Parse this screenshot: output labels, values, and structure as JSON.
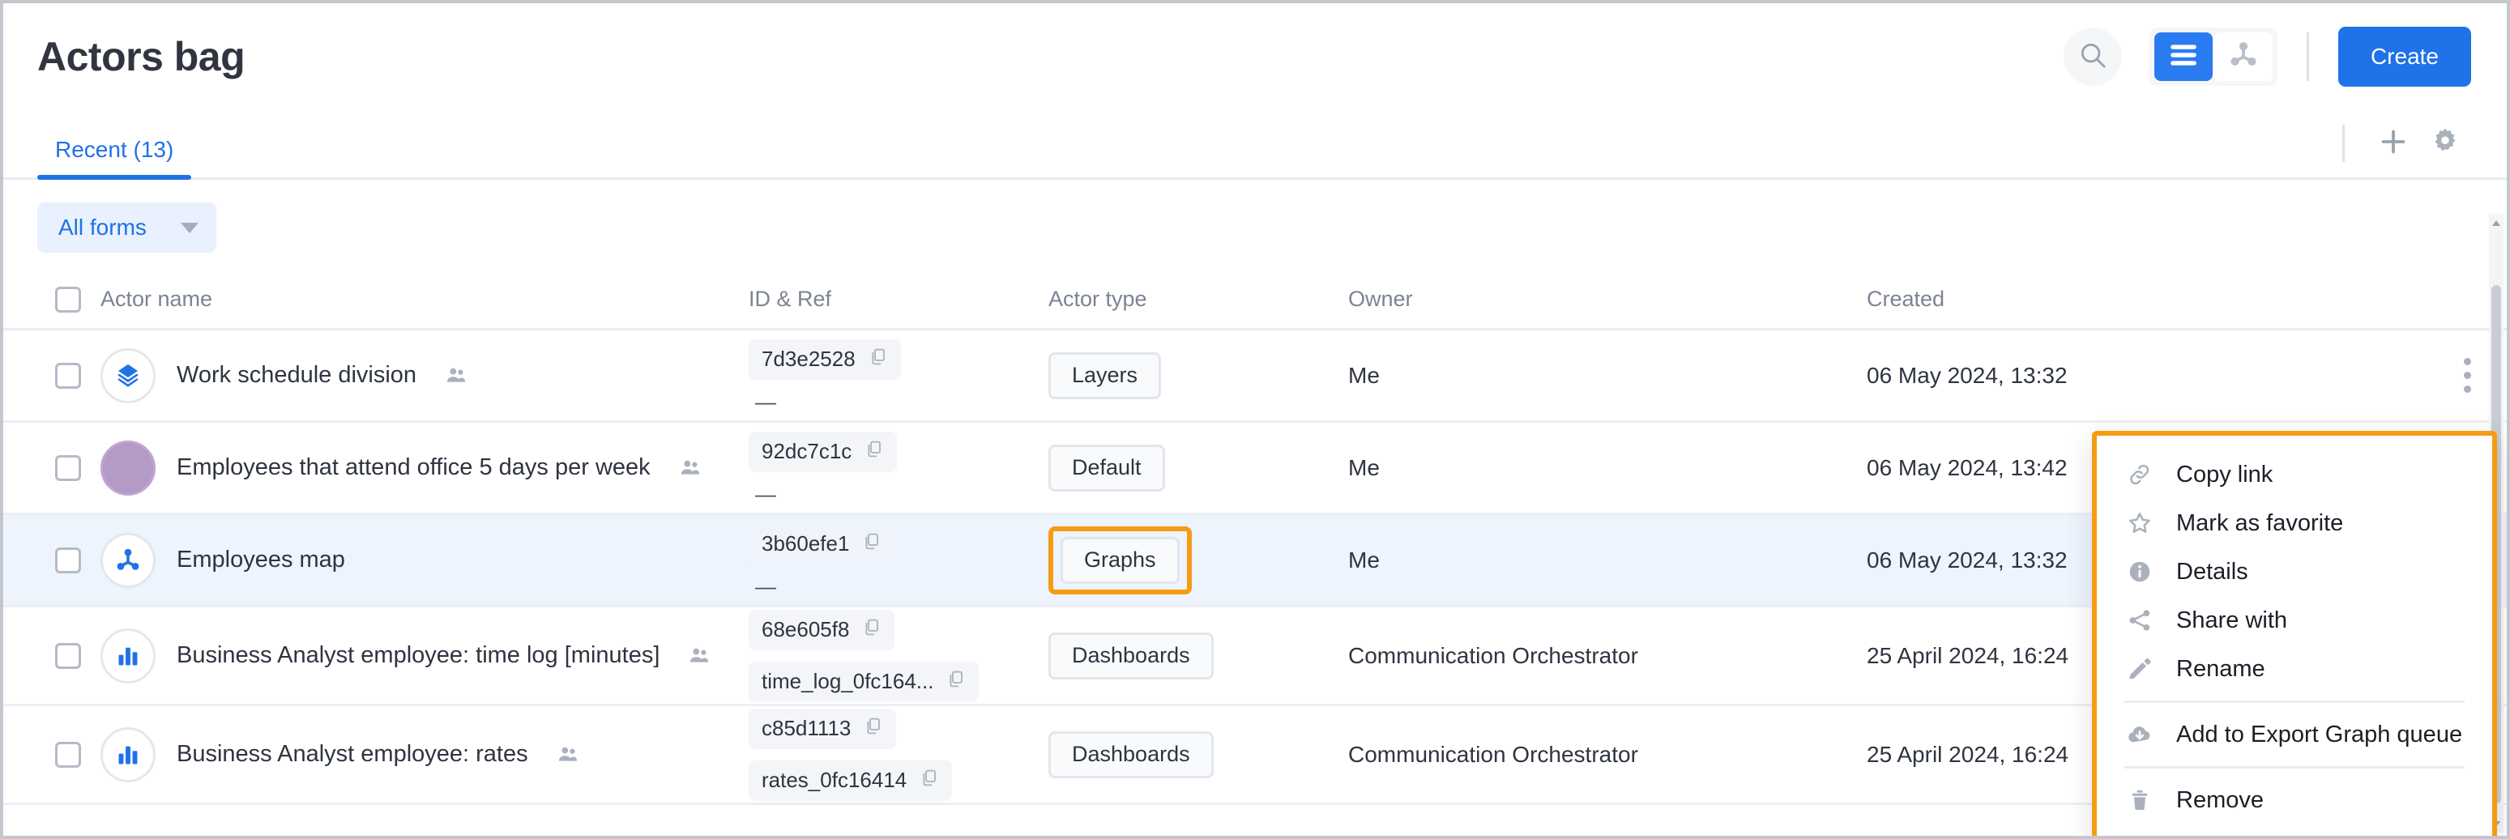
{
  "header": {
    "title": "Actors bag",
    "search_icon": "search-icon",
    "view_list_icon": "list-view-icon",
    "view_graph_icon": "graph-view-icon",
    "create_label": "Create"
  },
  "tabs": {
    "items": [
      {
        "label": "Recent (13)",
        "active": true
      }
    ],
    "add_icon": "plus-icon",
    "settings_icon": "gear-icon"
  },
  "filter": {
    "label": "All forms",
    "caret_icon": "chevron-down-icon"
  },
  "table": {
    "columns": [
      {
        "key": "name",
        "label": "Actor name"
      },
      {
        "key": "id",
        "label": "ID & Ref"
      },
      {
        "key": "type",
        "label": "Actor type"
      },
      {
        "key": "owner",
        "label": "Owner"
      },
      {
        "key": "created",
        "label": "Created"
      }
    ],
    "rows": [
      {
        "avatar": "layers-icon",
        "name": "Work schedule division",
        "shared": true,
        "ids": [
          "7d3e2528"
        ],
        "ref_placeholder": "—",
        "type": "Layers",
        "type_highlight": false,
        "owner": "Me",
        "created": "06 May 2024, 13:32",
        "selected": false,
        "has_kebab": true
      },
      {
        "avatar": "circle-avatar",
        "name": "Employees that attend office 5 days per week",
        "shared": true,
        "ids": [
          "92dc7c1c"
        ],
        "ref_placeholder": "—",
        "type": "Default",
        "type_highlight": false,
        "owner": "Me",
        "created": "06 May 2024, 13:42",
        "selected": false,
        "has_kebab": false
      },
      {
        "avatar": "graph-node-icon",
        "name": "Employees map",
        "shared": false,
        "ids": [
          "3b60efe1"
        ],
        "ref_placeholder": "—",
        "type": "Graphs",
        "type_highlight": true,
        "owner": "Me",
        "created": "06 May 2024, 13:32",
        "selected": true,
        "has_kebab": false
      },
      {
        "avatar": "bar-chart-icon",
        "name": "Business Analyst employee: time log [minutes]",
        "shared": true,
        "ids": [
          "68e605f8",
          "time_log_0fc164..."
        ],
        "ref_placeholder": "",
        "type": "Dashboards",
        "type_highlight": false,
        "owner": "Communication Orchestrator",
        "created": "25 April 2024, 16:24",
        "selected": false,
        "has_kebab": false
      },
      {
        "avatar": "bar-chart-icon",
        "name": "Business Analyst employee: rates",
        "shared": true,
        "ids": [
          "c85d1113",
          "rates_0fc16414"
        ],
        "ref_placeholder": "",
        "type": "Dashboards",
        "type_highlight": false,
        "owner": "Communication Orchestrator",
        "created": "25 April 2024, 16:24",
        "selected": false,
        "has_kebab": false
      }
    ],
    "copy_icon": "copy-icon",
    "shared_icon": "shared-users-icon",
    "kebab_icon": "more-vertical-icon"
  },
  "context_menu": {
    "items": [
      {
        "label": "Copy link",
        "icon": "link-icon",
        "sep_after": false
      },
      {
        "label": "Mark as favorite",
        "icon": "star-icon",
        "sep_after": false
      },
      {
        "label": "Details",
        "icon": "info-icon",
        "sep_after": false
      },
      {
        "label": "Share with",
        "icon": "share-icon",
        "sep_after": false
      },
      {
        "label": "Rename",
        "icon": "pencil-icon",
        "sep_after": true
      },
      {
        "label": "Add to Export Graph queue",
        "icon": "cloud-download-icon",
        "sep_after": true
      },
      {
        "label": "Remove",
        "icon": "trash-icon",
        "sep_after": false
      }
    ]
  },
  "colors": {
    "accent": "#1f72e8",
    "highlight": "#f59b14",
    "row_selected": "#eef4fd",
    "avatar_purple": "#b49ac6"
  }
}
